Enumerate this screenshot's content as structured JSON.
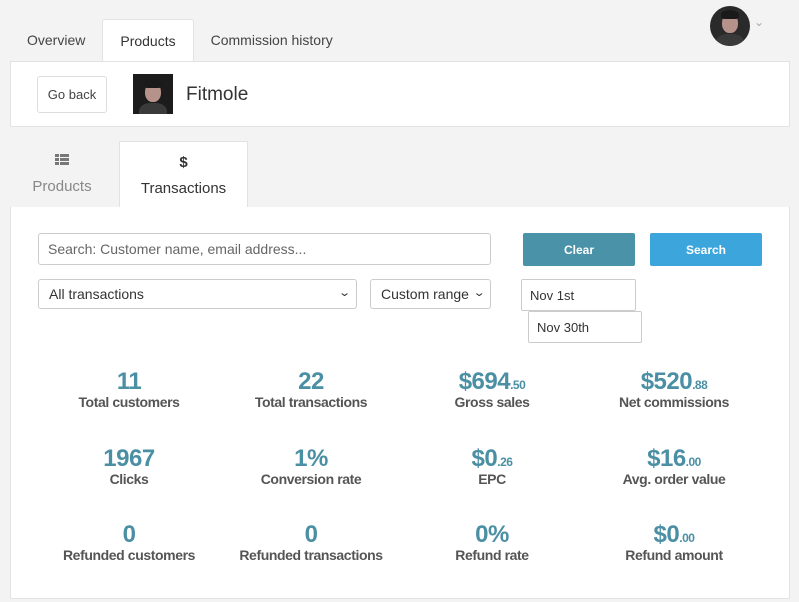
{
  "nav": {
    "tabs": [
      {
        "label": "Overview"
      },
      {
        "label": "Products"
      },
      {
        "label": "Commission history"
      }
    ]
  },
  "header": {
    "go_back_label": "Go back",
    "brand_name": "Fitmole"
  },
  "subtabs": [
    {
      "label": "Products",
      "icon": "grid-icon"
    },
    {
      "label": "Transactions",
      "icon": "dollar-icon"
    }
  ],
  "filters": {
    "search_placeholder": "Search: Customer name, email address...",
    "clear_label": "Clear",
    "search_label": "Search",
    "transaction_type": "All transactions",
    "range_type": "Custom range",
    "date_start": "Nov 1st",
    "date_end": "Nov 30th"
  },
  "stats": {
    "total_customers": {
      "value": "11",
      "label": "Total customers"
    },
    "total_transactions": {
      "value": "22",
      "label": "Total transactions"
    },
    "gross_sales": {
      "value": "$694",
      "cents": ".50",
      "label": "Gross sales"
    },
    "net_commissions": {
      "value": "$520",
      "cents": ".88",
      "label": "Net commissions"
    },
    "clicks": {
      "value": "1967",
      "label": "Clicks"
    },
    "conversion_rate": {
      "value": "1%",
      "label": "Conversion rate"
    },
    "epc": {
      "value": "$0",
      "cents": ".26",
      "label": "EPC"
    },
    "avg_order_value": {
      "value": "$16",
      "cents": ".00",
      "label": "Avg. order value"
    },
    "refunded_customers": {
      "value": "0",
      "label": "Refunded customers"
    },
    "refunded_transactions": {
      "value": "0",
      "label": "Refunded transactions"
    },
    "refund_rate": {
      "value": "0%",
      "label": "Refund rate"
    },
    "refund_amount": {
      "value": "$0",
      "cents": ".00",
      "label": "Refund amount"
    }
  },
  "colors": {
    "stat_value": "#4a8fa3",
    "clear_button": "#4a92a8",
    "search_button": "#3ba5dc"
  }
}
